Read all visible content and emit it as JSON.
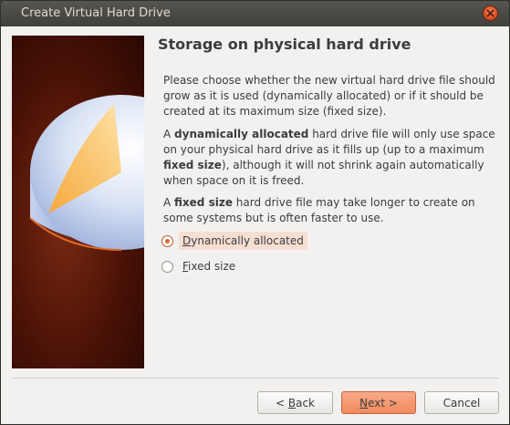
{
  "window": {
    "title": "Create Virtual Hard Drive"
  },
  "page": {
    "heading": "Storage on physical hard drive",
    "para1": "Please choose whether the new virtual hard drive file should grow as it is used (dynamically allocated) or if it should be created at its maximum size (fixed size).",
    "para2": {
      "a": "A ",
      "b": "dynamically allocated",
      "c": " hard drive file will only use space on your physical hard drive as it fills up (up to a maximum ",
      "d": "fixed size",
      "e": "), although it will not shrink again automatically when space on it is freed."
    },
    "para3": {
      "a": "A ",
      "b": "fixed size",
      "c": " hard drive file may take longer to create on some systems but is often faster to use."
    }
  },
  "options": [
    {
      "label_u": "D",
      "label_rest": "ynamically allocated",
      "selected": true
    },
    {
      "label_u": "F",
      "label_rest": "ixed size",
      "selected": false
    }
  ],
  "buttons": {
    "back": {
      "pre": "< ",
      "u": "B",
      "rest": "ack"
    },
    "next": {
      "pre": "",
      "u": "N",
      "rest": "ext >"
    },
    "cancel": {
      "label": "Cancel"
    }
  },
  "icons": {
    "close": "close-icon",
    "banner": "hard-drive-illustration"
  },
  "colors": {
    "accent": "#e0682f",
    "titlebar": "#403f3a"
  }
}
